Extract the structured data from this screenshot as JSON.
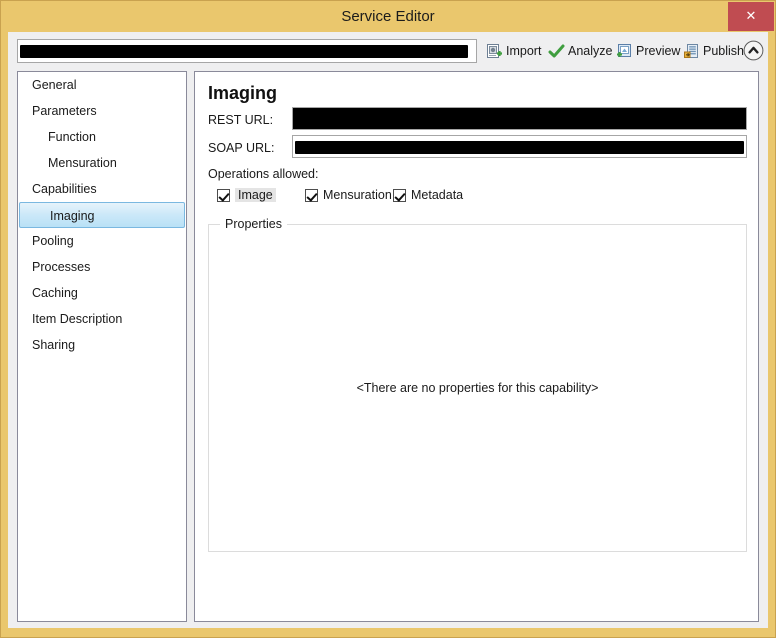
{
  "window": {
    "title": "Service Editor",
    "close_label": "✕",
    "frame_color": "#eac76d",
    "close_color": "#c04c51"
  },
  "toolbar": {
    "service_url_value": "",
    "service_url_redacted": true,
    "buttons": [
      {
        "label": "Import",
        "icon": "import-icon"
      },
      {
        "label": "Analyze",
        "icon": "check-icon"
      },
      {
        "label": "Preview",
        "icon": "preview-icon"
      },
      {
        "label": "Publish",
        "icon": "publish-icon"
      }
    ],
    "collapse_icon": "chevron-up-icon"
  },
  "sidebar": {
    "items": [
      {
        "label": "General",
        "level": 0,
        "selected": false
      },
      {
        "label": "Parameters",
        "level": 0,
        "selected": false
      },
      {
        "label": "Function",
        "level": 1,
        "selected": false
      },
      {
        "label": "Mensuration",
        "level": 1,
        "selected": false
      },
      {
        "label": "Capabilities",
        "level": 0,
        "selected": false
      },
      {
        "label": "Imaging",
        "level": 1,
        "selected": true
      },
      {
        "label": "Pooling",
        "level": 0,
        "selected": false
      },
      {
        "label": "Processes",
        "level": 0,
        "selected": false
      },
      {
        "label": "Caching",
        "level": 0,
        "selected": false
      },
      {
        "label": "Item Description",
        "level": 0,
        "selected": false
      },
      {
        "label": "Sharing",
        "level": 0,
        "selected": false
      }
    ]
  },
  "main": {
    "title": "Imaging",
    "rest_url_label": "REST URL:",
    "rest_url_value": "",
    "rest_url_redacted": true,
    "soap_url_label": "SOAP URL:",
    "soap_url_value": "",
    "soap_url_redacted": true,
    "operations_label": "Operations allowed:",
    "operations": [
      {
        "label": "Image",
        "checked": true,
        "focused": true
      },
      {
        "label": "Mensuration",
        "checked": true,
        "focused": false
      },
      {
        "label": "Metadata",
        "checked": true,
        "focused": false
      }
    ],
    "properties_legend": "Properties",
    "properties_empty_text": "<There are no properties for this capability>"
  }
}
